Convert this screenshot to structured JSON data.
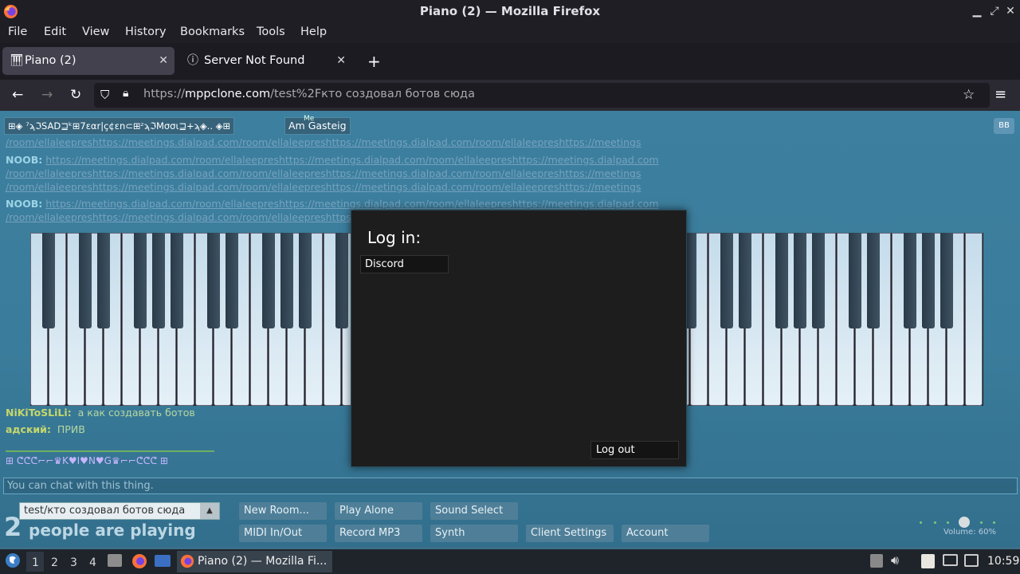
{
  "window": {
    "title": "Piano (2) — Mozilla Firefox"
  },
  "menu": [
    "File",
    "Edit",
    "View",
    "History",
    "Bookmarks",
    "Tools",
    "Help"
  ],
  "tabs": [
    {
      "label": "Piano (2)",
      "active": true
    },
    {
      "label": "Server Not Found",
      "active": false
    }
  ],
  "url": {
    "prefix": "https://",
    "host": "mppclone.com",
    "path": "/test%2Fкто создовал ботов сюда"
  },
  "room": {
    "badges": [
      "⊞◈ ⁷ϡℑSAD⊒ᵏ⊞7εαr|ç¢εn⊂⊞ᶻϡℑMσσι⊒+ϡ◈.. ◈⊞",
      "Am Gasteig"
    ],
    "me_label": "Me",
    "corner_button": "BB"
  },
  "chat": {
    "nick_noob": "NOOB:",
    "link_text": "https://meetings.dialpad.com/room/ellaleepreshttps://meetings.dialpad.com/room/ellaleepreshttps://meetings.dialpad.com",
    "link_text2": "/room/ellaleepreshttps://meetings.dialpad.com/room/ellaleepreshttps://meetings.dialpad.com/room/ellaleepreshttps://meetings",
    "msg1_nick": "NiKiToSLiLi:",
    "msg1_text": "а как создавать ботов",
    "msg2_nick": "адский:",
    "msg2_text": "ПРИВ",
    "fancy_line": "⊞  ᕦᕦᕦ⌐⌐♛K♥I♥N♥G♛⌐⌐ᕦᕦᕦ  ⊞",
    "input_placeholder": "You can chat with this thing."
  },
  "modal": {
    "title": "Log in:",
    "discord_button": "Discord",
    "logout_button": "Log out"
  },
  "bottom": {
    "room_select": "test/кто создовал ботов сюда",
    "player_count": "2",
    "player_label": "people are playing",
    "buttons_row1": [
      "New Room...",
      "Play Alone",
      "Sound Select"
    ],
    "buttons_row2": [
      "MIDI In/Out",
      "Record MP3",
      "Synth",
      "Client Settings",
      "Account"
    ],
    "volume_label": "Volume: 60%",
    "volume": 0.6
  },
  "taskbar": {
    "workspaces": [
      "1",
      "2",
      "3",
      "4"
    ],
    "active_window": "Piano (2) — Mozilla Fi...",
    "clock": "10:59"
  }
}
